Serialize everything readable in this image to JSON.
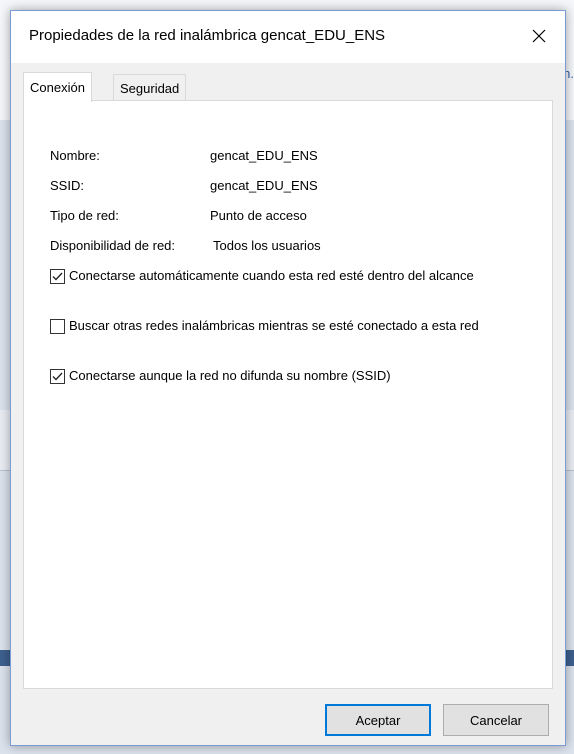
{
  "background": {
    "hint_text": "n."
  },
  "dialog": {
    "title": "Propiedades de la red inalámbrica gencat_EDU_ENS",
    "close_icon": "close-icon",
    "tabs": [
      {
        "label": "Conexión",
        "active": true
      },
      {
        "label": "Seguridad",
        "active": false
      }
    ],
    "info": [
      {
        "label": "Nombre:",
        "value": "gencat_EDU_ENS"
      },
      {
        "label": "SSID:",
        "value": "gencat_EDU_ENS"
      },
      {
        "label": "Tipo de red:",
        "value": "Punto de acceso"
      },
      {
        "label": "Disponibilidad de red:",
        "value": "Todos los usuarios"
      }
    ],
    "checkboxes": [
      {
        "label": "Conectarse automáticamente cuando esta red esté dentro del alcance",
        "checked": true
      },
      {
        "label": "Buscar otras redes inalámbricas mientras se esté conectado a esta red",
        "checked": false
      },
      {
        "label": "Conectarse aunque la red no difunda su nombre (SSID)",
        "checked": true
      }
    ],
    "buttons": {
      "ok": "Aceptar",
      "cancel": "Cancelar"
    },
    "colors": {
      "accent": "#0078d7",
      "panel": "#ffffff",
      "chrome": "#f0f0f0"
    }
  }
}
